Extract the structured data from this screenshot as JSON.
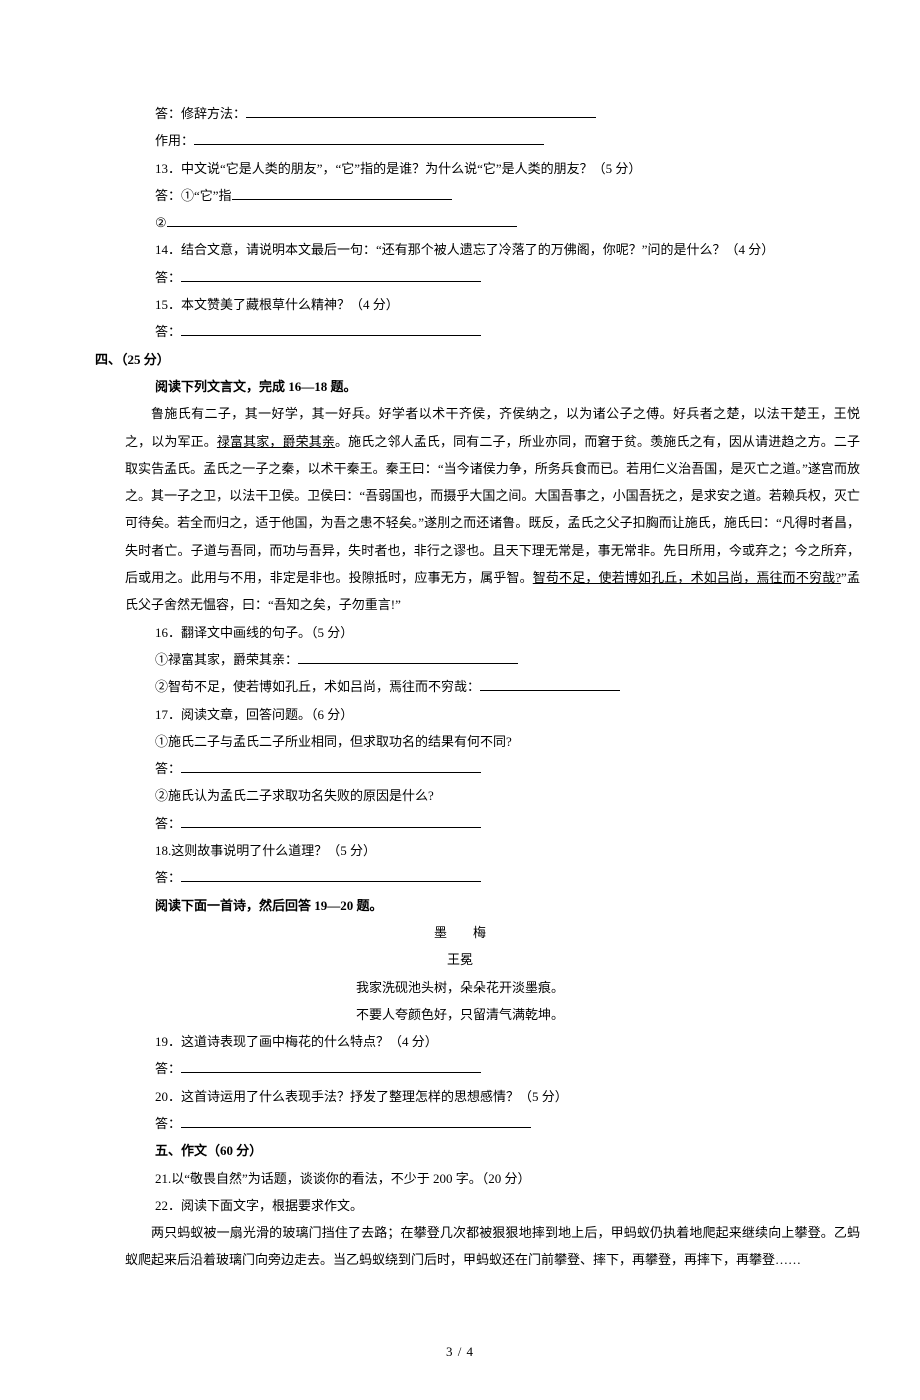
{
  "q12": {
    "ans_label1": "答：修辞方法：",
    "ans_label2": "作用："
  },
  "q13": {
    "text": "13．中文说“它是人类的朋友”，“它”指的是谁？为什么说“它”是人类的朋友？（5 分）",
    "ans1": "答：①“它”指",
    "ans2": "②"
  },
  "q14": {
    "text": "14．结合文意，请说明本文最后一句：“还有那个被人遗忘了冷落了的万佛阁，你呢？”问的是什么？（4 分）",
    "ans": "答："
  },
  "q15": {
    "text": "15．本文赞美了藏根草什么精神？（4 分）",
    "ans": "答："
  },
  "section4": {
    "heading": "四、（25 分）",
    "subheading": "阅读下列文言文，完成 16—18 题。",
    "passage_pre": "鲁施氏有二子，其一好学，其一好兵。好学者以术干齐侯，齐侯纳之，以为诸公子之傅。好兵者之楚，以法干楚王，王悦之，以为军正。",
    "passage_u1": "禄富其家，爵荣其亲",
    "passage_mid1": "。施氏之邻人孟氏，同有二子，所业亦同，而窘于贫。羡施氏之有，因从请进趋之方。二子取实告孟氏。孟氏之一子之秦，以术干秦王。秦王曰：“当今诸侯力争，所务兵食而已。若用仁义治吾国，是灭亡之道。”遂宫而放之。其一子之卫，以法干卫侯。卫侯曰：“吾弱国也，而摄乎大国之间。大国吾事之，小国吾抚之，是求安之道。若赖兵权，灭亡可待矣。若全而归之，适于他国，为吾之患不轻矣。”遂刖之而还诸鲁。既反，孟氏之父子扣胸而让施氏，施氏曰：“凡得时者昌，失时者亡。子道与吾同，而功与吾异，失时者也，非行之谬也。且天下理无常是，事无常非。先日所用，今或弃之；今之所弃，后或用之。此用与不用，非定是非也。投隙抵时，应事无方，属乎智。",
    "passage_u2": "智苟不足，使若博如孔丘，术如吕尚，焉往而不穷哉?",
    "passage_mid2": "”孟氏父子舍然无愠容，曰：“吾知之矣，子勿重言!”"
  },
  "q16": {
    "text": "16．翻译文中画线的句子。（5 分）",
    "a1": "①禄富其家，爵荣其亲：",
    "a2": "②智苟不足，使若博如孔丘，术如吕尚，焉往而不穷哉："
  },
  "q17": {
    "text": "17．阅读文章，回答问题。（6 分）",
    "sub1": "①施氏二子与孟氏二子所业相同，但求取功名的结果有何不同?",
    "sub2": "②施氏认为孟氏二子求取功名失败的原因是什么?",
    "ans": "答："
  },
  "q18": {
    "text": "18.这则故事说明了什么道理？（5 分）",
    "ans": "答："
  },
  "poem_section": {
    "heading": "阅读下面一首诗，然后回答 19—20 题。",
    "title": "墨　　梅",
    "author": "王冕",
    "line1": "我家洗砚池头树，朵朵花开淡墨痕。",
    "line2": "不要人夸颜色好，只留清气满乾坤。"
  },
  "q19": {
    "text": "19．这道诗表现了画中梅花的什么特点？（4 分）",
    "ans": "答："
  },
  "q20": {
    "text": "20．这首诗运用了什么表现手法？抒发了整理怎样的思想感情？（5 分）",
    "ans": "答："
  },
  "section5": {
    "heading": "五、作文（60 分）",
    "q21": "21.以“敬畏自然”为话题，谈谈你的看法，不少于 200 字。（20 分）",
    "q22": "22．阅读下面文字，根据要求作文。",
    "prompt": "两只蚂蚁被一扇光滑的玻璃门挡住了去路；在攀登几次都被狠狠地摔到地上后，甲蚂蚁仍执着地爬起来继续向上攀登。乙蚂蚁爬起来后沿着玻璃门向旁边走去。当乙蚂蚁绕到门后时，甲蚂蚁还在门前攀登、摔下，再攀登，再摔下，再攀登……"
  },
  "footer": "3 / 4"
}
